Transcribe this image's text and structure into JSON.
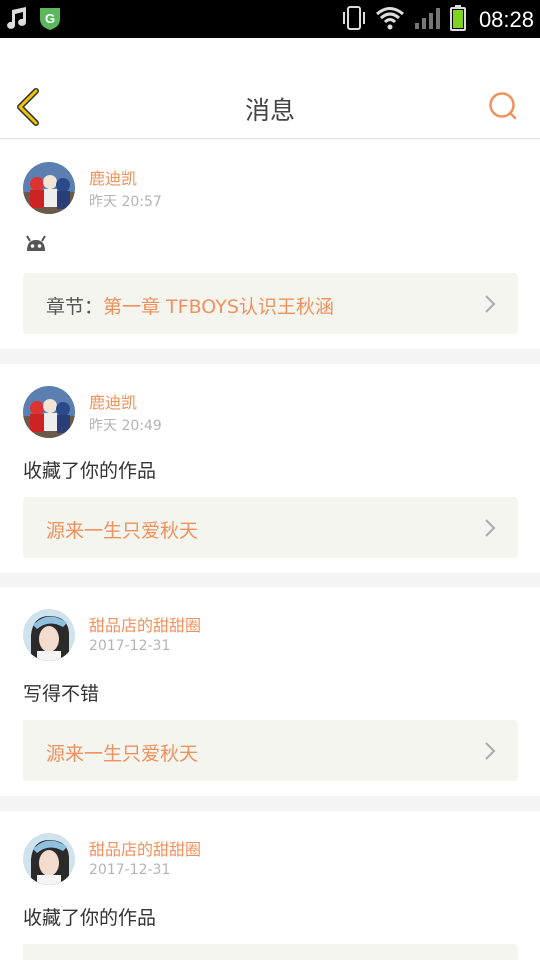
{
  "status_bar": {
    "time": "08:28",
    "icons": [
      "music-icon",
      "app-shield-icon",
      "phone-vibrate-icon",
      "wifi-icon",
      "signal-icon",
      "battery-icon"
    ]
  },
  "header": {
    "title": "消息",
    "back_icon": "chevron-left-icon",
    "search_icon": "search-icon"
  },
  "colors": {
    "accent": "#f0915d",
    "back_arrow": "#f2c400",
    "link_box": "#f5f5f0"
  },
  "messages": [
    {
      "user": "鹿迪凯",
      "time": "昨天 20:57",
      "content": "",
      "content_icon": "android-robot-icon",
      "link_prefix": "章节：",
      "link_text": "第一章  TFBOYS认识王秋涵"
    },
    {
      "user": "鹿迪凯",
      "time": "昨天 20:49",
      "content": "收藏了你的作品",
      "link_prefix": "",
      "link_text": "源来一生只爱秋天"
    },
    {
      "user": "甜品店的甜甜圈",
      "time": "2017-12-31",
      "content": "写得不错",
      "link_prefix": "",
      "link_text": "源来一生只爱秋天"
    },
    {
      "user": "甜品店的甜甜圈",
      "time": "2017-12-31",
      "content": "收藏了你的作品",
      "link_prefix": "",
      "link_text": ""
    }
  ]
}
